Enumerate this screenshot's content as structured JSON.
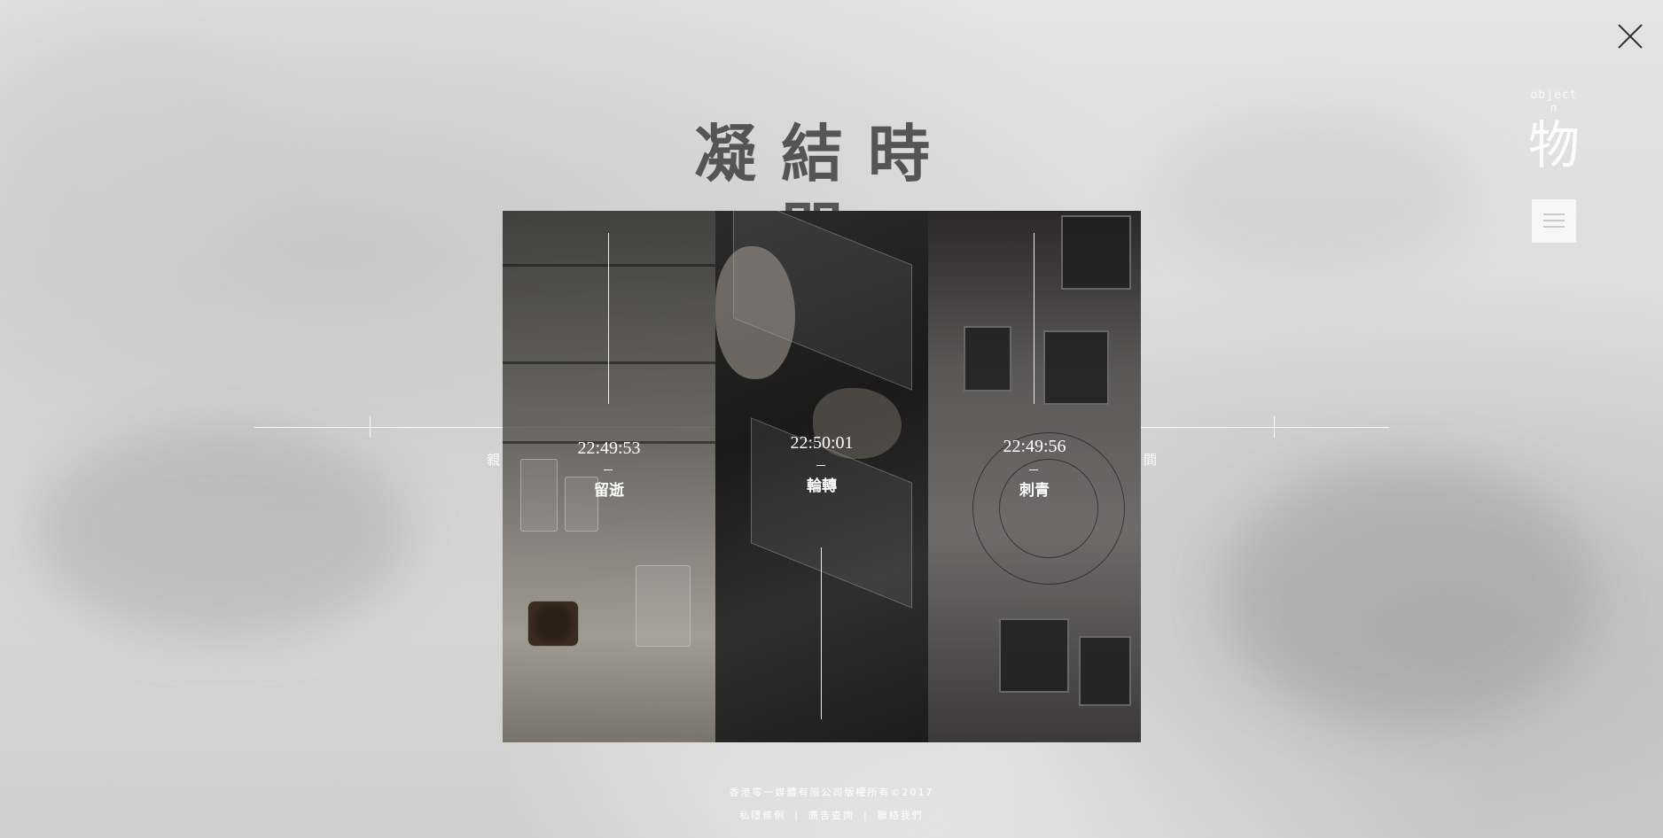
{
  "page": {
    "title": "凝結時間",
    "close_icon": "close-icon"
  },
  "brand": {
    "subtitle": "object n",
    "name": "物",
    "menu_icon": "hamburger-icon"
  },
  "timeline": {
    "left_label": "親",
    "right_label": "間"
  },
  "panels": [
    {
      "time": "22:49:53",
      "name": "留逝"
    },
    {
      "time": "22:50:01",
      "name": "輪轉"
    },
    {
      "time": "22:49:56",
      "name": "刺青"
    }
  ],
  "footer": {
    "copyright": "香港零一媒體有限公司版權所有©2017",
    "links": [
      "私隱條例",
      "廣告查詢",
      "聯絡我們"
    ],
    "separator": "|"
  },
  "colors": {
    "title": "#555555",
    "text_on_image": "#ffffff",
    "background": "#dcdcdc"
  }
}
